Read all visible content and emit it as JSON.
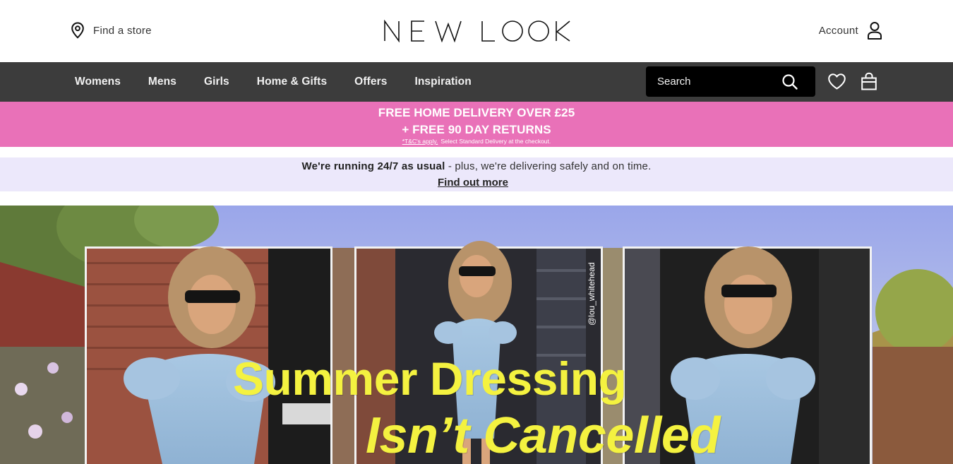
{
  "header": {
    "store_label": "Find a store",
    "logo_text": "NEW LOOK",
    "account_label": "Account"
  },
  "nav": {
    "items": [
      {
        "label": "Womens"
      },
      {
        "label": "Mens"
      },
      {
        "label": "Girls"
      },
      {
        "label": "Home & Gifts"
      },
      {
        "label": "Offers"
      },
      {
        "label": "Inspiration"
      }
    ],
    "search_placeholder": "Search"
  },
  "promo": {
    "line1": "FREE HOME DELIVERY OVER £25",
    "line2": "+ FREE 90 DAY RETURNS",
    "terms_link": "*T&C's apply.",
    "terms_text": "Select Standard Delivery at the checkout.",
    "bg_color": "#e971b8"
  },
  "info": {
    "bold_text": "We're running 24/7 as usual",
    "rest_text": " - plus, we're delivering safely and on time.",
    "link": "Find out more",
    "bg_color": "#ece8fb"
  },
  "hero": {
    "title_line1": "Summer Dressing",
    "title_line2": "Isn’t Cancelled",
    "credit": "@lou_whitehead",
    "title_color": "#f4f240"
  },
  "colors": {
    "navbar": "#3c3c3c",
    "search_bg": "#000000"
  },
  "icons": [
    "location-pin-icon",
    "user-icon",
    "search-icon",
    "heart-icon",
    "shopping-bag-icon"
  ]
}
